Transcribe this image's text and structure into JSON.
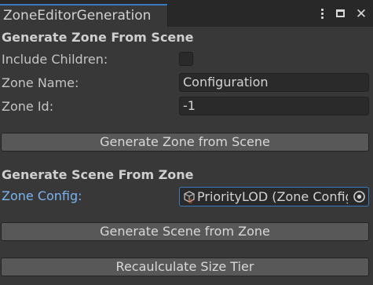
{
  "window": {
    "tab_title": "ZoneEditorGeneration",
    "menu_icon": "kebab-menu-icon",
    "maximize_icon": "maximize-icon",
    "close_icon": "close-icon",
    "close_glyph": "✕"
  },
  "generate_zone": {
    "header": "Generate Zone From Scene",
    "include_children_label": "Include Children:",
    "include_children_checked": false,
    "zone_name_label": "Zone Name:",
    "zone_name_value": "Configuration",
    "zone_id_label": "Zone Id:",
    "zone_id_value": "-1",
    "button_label": "Generate Zone from Scene"
  },
  "generate_scene": {
    "header": "Generate Scene From Zone",
    "zone_config_label": "Zone Config:",
    "zone_config_value": "PriorityLOD (Zone Config)",
    "zone_config_icon": "scriptable-object-icon",
    "picker_icon": "object-picker-icon",
    "button_label": "Generate Scene from Zone"
  },
  "recalc": {
    "button_label": "Recaulculate Size Tier"
  },
  "colors": {
    "background": "#383838",
    "tabbar": "#282828",
    "accent": "#3a79bb",
    "label_highlight": "#7ab3f0",
    "button": "#585858",
    "field": "#2a2a2a"
  }
}
